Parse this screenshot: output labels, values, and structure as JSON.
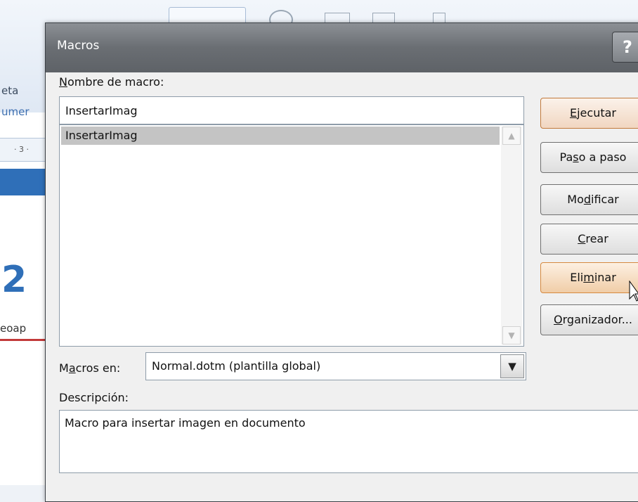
{
  "background": {
    "label_top": "eta",
    "label_link": "umer",
    "ruler_text": "· 3 ·",
    "big_number": "2",
    "partial_text": "eoap"
  },
  "dialog": {
    "title": "Macros",
    "help_label": "?",
    "name_label_key": "N",
    "name_label_rest": "ombre de macro:",
    "name_value": "InsertarImag",
    "macros": [
      "InsertarImag"
    ],
    "buttons": {
      "run": {
        "pre": "",
        "key": "E",
        "post": "jecutar"
      },
      "step": {
        "pre": "Pa",
        "key": "s",
        "post": "o a paso"
      },
      "edit": {
        "pre": "Mo",
        "key": "d",
        "post": "ificar"
      },
      "create": {
        "pre": "",
        "key": "C",
        "post": "rear"
      },
      "delete": {
        "pre": "Eli",
        "key": "m",
        "post": "inar"
      },
      "organizer": {
        "pre": "",
        "key": "O",
        "post": "rganizador..."
      }
    },
    "macros_in_pre": "M",
    "macros_in_key": "a",
    "macros_in_post": "cros en:",
    "macros_in_value": "Normal.dotm (plantilla global)",
    "description_label": "Descripción:",
    "description_value": "Macro para insertar imagen en documento"
  }
}
